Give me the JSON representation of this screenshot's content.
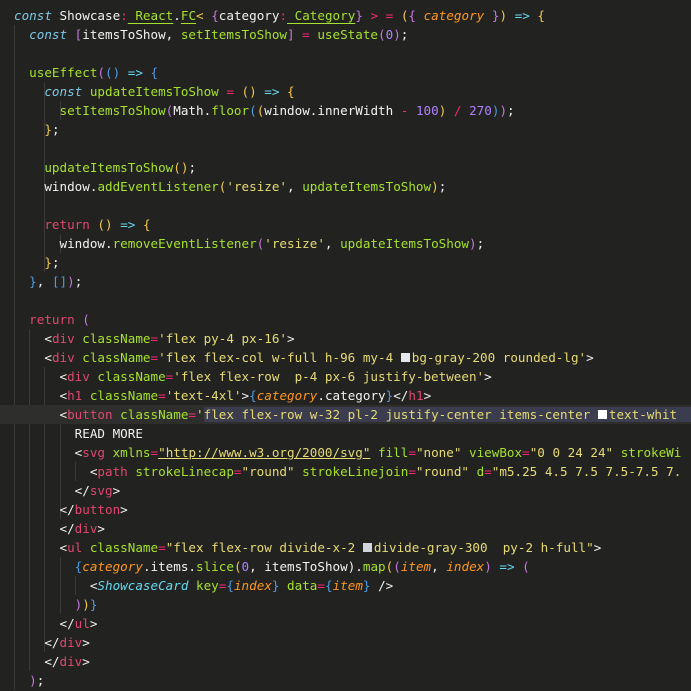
{
  "editor": {
    "theme_colors": {
      "background": "#222221",
      "keyword": "#7ec8e3",
      "return": "#e0476f",
      "function": "#a6e22e",
      "string": "#e6db74",
      "number": "#ae81ff",
      "parameter": "#fd971f",
      "tag": "#e0476f",
      "selection": "#3b3c4e"
    },
    "highlighted_line": 22,
    "lines": [
      "const Showcase: React.FC< {category: Category} > = ({ category }) => {",
      "  const [itemsToShow, setItemsToShow] = useState(0);",
      "",
      "  useEffect(() => {",
      "    const updateItemsToShow = () => {",
      "      setItemsToShow(Math.floor((window.innerWidth - 100) / 270));",
      "    };",
      "",
      "    updateItemsToShow();",
      "    window.addEventListener('resize', updateItemsToShow);",
      "",
      "    return () => {",
      "      window.removeEventListener('resize', updateItemsToShow);",
      "    };",
      "  }, []);",
      "",
      "  return (",
      "    <div className='flex py-4 px-16'>",
      "    <div className='flex flex-col w-full h-96 my-4 bg-gray-200 rounded-lg'>",
      "      <div className='flex flex-row  p-4 px-6 justify-between'>",
      "      <h1 className='text-4xl'>{category.category}</h1>",
      "      <button className='flex flex-row w-32 pl-2 justify-center items-center text-whit",
      "        READ MORE",
      "        <svg xmlns=\"http://www.w3.org/2000/svg\" fill=\"none\" viewBox=\"0 0 24 24\" strokeWi",
      "          <path strokeLinecap=\"round\" strokeLinejoin=\"round\" d=\"m5.25 4.5 7.5 7.5-7.5 7.",
      "        </svg>",
      "      </button>",
      "      </div>",
      "      <ul className=\"flex flex-row divide-x-2 divide-gray-300  py-2 h-full\">",
      "        {category.items.slice(0, itemsToShow).map((item, index) => (",
      "          <ShowcaseCard key={index} data={item} />",
      "        ))}",
      "      </ul>",
      "    </div>",
      "    </div>",
      "  );"
    ],
    "tokens": {
      "l1": [
        "const",
        " Showcase",
        ":",
        " React",
        ".",
        "FC",
        "<",
        " {",
        "category",
        ":",
        " Category",
        "}",
        " >",
        " =",
        " (",
        "{",
        " category",
        " }",
        ")",
        " =>",
        " {"
      ],
      "l2": [
        "const",
        " [",
        "itemsToShow",
        ", ",
        "setItemsToShow",
        "]",
        " =",
        " useState",
        "(",
        "0",
        ")",
        ";"
      ],
      "l4": [
        "useEffect",
        "(",
        "(",
        ")",
        " =>",
        " {"
      ],
      "l5": [
        "const",
        " updateItemsToShow",
        " =",
        " (",
        ")",
        " =>",
        " {"
      ],
      "l6": [
        "setItemsToShow",
        "(",
        "Math",
        ".",
        "floor",
        "(",
        "(",
        "window",
        ".",
        "innerWidth",
        " -",
        " 100",
        ")",
        " /",
        " 270",
        ")",
        ")",
        ";"
      ],
      "l7": [
        "}",
        ";"
      ],
      "l9": [
        "updateItemsToShow",
        "(",
        ")",
        ";"
      ],
      "l10": [
        "window",
        ".",
        "addEventListener",
        "(",
        "'resize'",
        ", ",
        "updateItemsToShow",
        ")",
        ";"
      ],
      "l12": [
        "return",
        " (",
        ")",
        " =>",
        " {"
      ],
      "l13": [
        "window",
        ".",
        "removeEventListener",
        "(",
        "'resize'",
        ", ",
        "updateItemsToShow",
        ")",
        ";"
      ],
      "l14": [
        "}",
        ";"
      ],
      "l15": [
        "}",
        ", ",
        "[",
        "]",
        ")",
        ";"
      ],
      "l17": [
        "return",
        " ("
      ],
      "l18": [
        "<",
        "div",
        " className",
        "=",
        "'flex py-4 px-16'",
        ">"
      ],
      "l19": [
        "<",
        "div",
        " className",
        "=",
        "'flex flex-col w-full h-96 my-4 ",
        "bg-gray-200 rounded-lg'",
        ">"
      ],
      "l20": [
        "<",
        "div",
        " className",
        "=",
        "'flex flex-row  p-4 px-6 justify-between'",
        ">"
      ],
      "l21": [
        "<",
        "h1",
        " className",
        "=",
        "'text-4xl'",
        ">",
        "{",
        "category",
        ".category",
        "}",
        "</",
        "h1",
        ">"
      ],
      "l22": [
        "<",
        "button",
        " className",
        "=",
        "'",
        "flex flex-row w-32 pl-2 justify-center items-center ",
        "text-whit"
      ],
      "l23": [
        "READ MORE"
      ],
      "l24": [
        "<",
        "svg",
        " xmlns",
        "=",
        "\"http://www.w3.org/2000/svg\"",
        " fill",
        "=",
        "\"none\"",
        " viewBox",
        "=",
        "\"0 0 24 24\"",
        " strokeWi"
      ],
      "l25": [
        "<",
        "path",
        " strokeLinecap",
        "=",
        "\"round\"",
        " strokeLinejoin",
        "=",
        "\"round\"",
        " d",
        "=",
        "\"m5.25 4.5 7.5 7.5-7.5 7."
      ],
      "l26": [
        "</",
        "svg",
        ">"
      ],
      "l27": [
        "</",
        "button",
        ">"
      ],
      "l28": [
        "</",
        "div",
        ">"
      ],
      "l29": [
        "<",
        "ul",
        " className",
        "=",
        "\"flex flex-row divide-x-2 ",
        "divide-gray-300  py-2 h-full\"",
        ">"
      ],
      "l30": [
        "{",
        "category",
        ".items.",
        "slice",
        "(",
        "0",
        ", itemsToShow)",
        ".",
        "map",
        "(",
        "(",
        "item",
        ", ",
        "index",
        ")",
        " =>",
        " ("
      ],
      "l31": [
        "<",
        "ShowcaseCard",
        " key",
        "=",
        "{",
        "index",
        "}",
        " data",
        "=",
        "{",
        "item",
        "}",
        " />"
      ],
      "l32": [
        ")",
        ")",
        "}"
      ],
      "l33": [
        "</",
        "ul",
        ">"
      ],
      "l34": [
        "</",
        "div",
        ">"
      ],
      "l35": [
        "</",
        "div",
        ">"
      ],
      "l36": [
        ")",
        ";"
      ]
    },
    "color_swatches": {
      "bg_gray_200": "#e5e7eb",
      "text_white": "#ffffff",
      "divide_gray_300": "#d1d5db"
    }
  }
}
